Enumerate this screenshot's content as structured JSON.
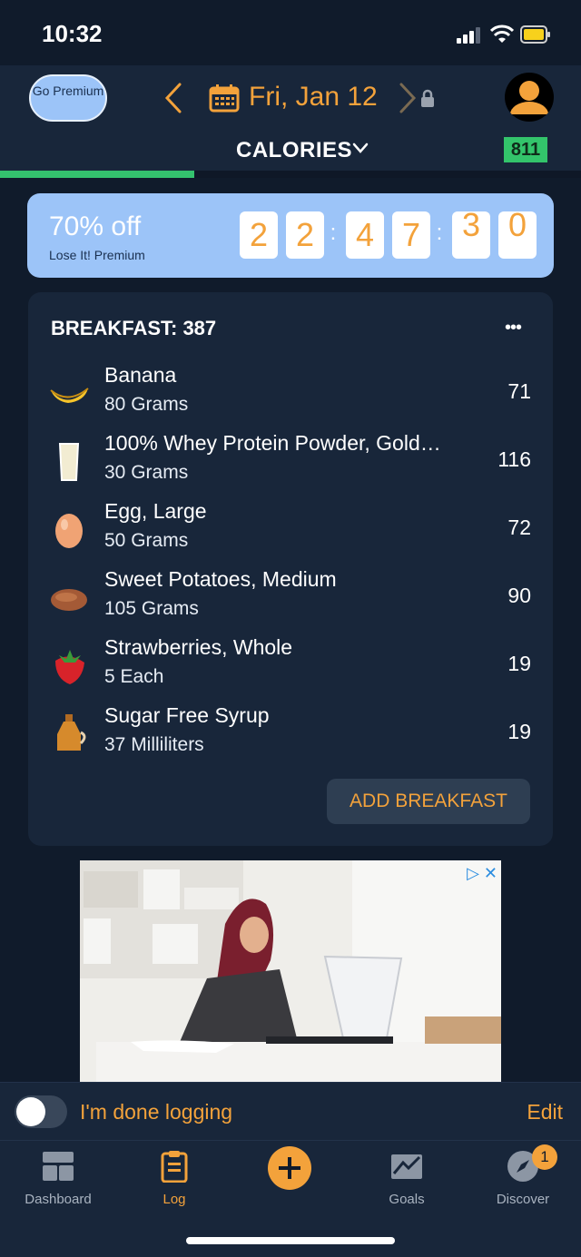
{
  "status": {
    "time": "10:32"
  },
  "header": {
    "premium_label": "Go Premium",
    "date": "Fri, Jan 12",
    "section_label": "CALORIES",
    "calorie_count": "811",
    "progress_fraction": 0.335
  },
  "promo": {
    "discount": "70% off",
    "subtitle": "Lose It! Premium",
    "countdown": [
      "2",
      "2",
      "4",
      "7",
      "3",
      "0"
    ]
  },
  "breakfast": {
    "title": "BREAKFAST: 387",
    "more_label": "•••",
    "items": [
      {
        "icon": "banana-icon",
        "name": "Banana",
        "qty": "80 Grams",
        "calories": "71"
      },
      {
        "icon": "milk-glass-icon",
        "name": "100% Whey Protein Powder, Gold…",
        "qty": "30 Grams",
        "calories": "116"
      },
      {
        "icon": "egg-icon",
        "name": "Egg, Large",
        "qty": "50 Grams",
        "calories": "72"
      },
      {
        "icon": "sweet-potato-icon",
        "name": "Sweet Potatoes, Medium",
        "qty": "105 Grams",
        "calories": "90"
      },
      {
        "icon": "strawberry-icon",
        "name": "Strawberries, Whole",
        "qty": "5 Each",
        "calories": "19"
      },
      {
        "icon": "syrup-bottle-icon",
        "name": "Sugar Free Syrup",
        "qty": "37 Milliliters",
        "calories": "19"
      }
    ],
    "add_label": "ADD BREAKFAST"
  },
  "ad": {
    "controls": "▷ ✕"
  },
  "done_bar": {
    "label": "I'm done logging",
    "edit_label": "Edit",
    "toggle_on": false
  },
  "tabs": [
    {
      "label": "Dashboard",
      "icon": "dashboard-icon"
    },
    {
      "label": "Log",
      "icon": "log-icon"
    },
    {
      "label": "",
      "icon": "plus-icon"
    },
    {
      "label": "Goals",
      "icon": "goals-icon"
    },
    {
      "label": "Discover",
      "icon": "compass-icon"
    }
  ],
  "discover_badge": "1",
  "colors": {
    "accent": "#f3a23b",
    "background": "#101b2b",
    "card": "#18263a",
    "premium_blue": "#9cc4f8",
    "success_green": "#34c26e"
  }
}
